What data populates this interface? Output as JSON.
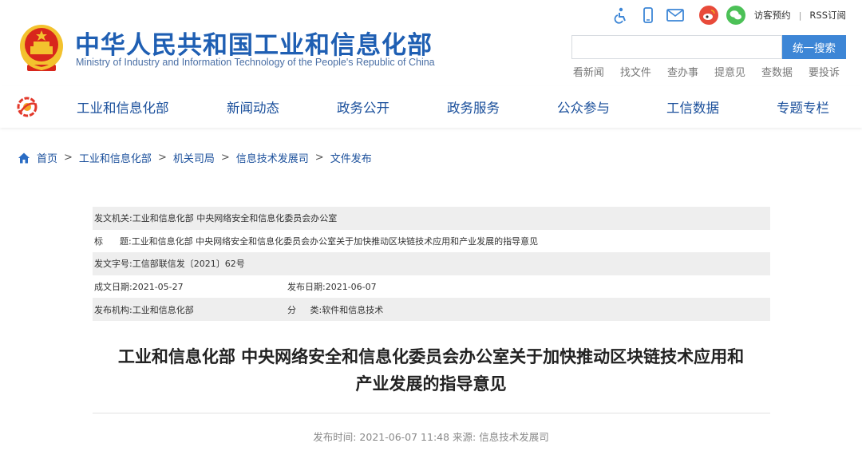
{
  "header": {
    "title": "中华人民共和国工业和信息化部",
    "subtitle": "Ministry of Industry and Information Technology of the People's Republic of China",
    "tools": {
      "icons": [
        "accessibility-icon",
        "mobile-icon",
        "mail-icon",
        "weibo-icon",
        "wechat-icon"
      ],
      "visitor_label": "访客预约",
      "sep": "|",
      "rss_label": "RSS订阅"
    },
    "search": {
      "placeholder": "",
      "button_label": "统一搜索"
    },
    "quick_links": [
      "看新闻",
      "找文件",
      "查办事",
      "提意见",
      "查数据",
      "要投诉"
    ]
  },
  "nav": {
    "items": [
      "工业和信息化部",
      "新闻动态",
      "政务公开",
      "政务服务",
      "公众参与",
      "工信数据",
      "专题专栏"
    ]
  },
  "breadcrumb": {
    "items": [
      "首页",
      "工业和信息化部",
      "机关司局",
      "信息技术发展司",
      "文件发布"
    ],
    "sep": ">"
  },
  "meta": {
    "issuer_label": "发文机关:",
    "issuer_value": "工业和信息化部 中央网络安全和信息化委员会办公室",
    "title_label": "标      题:",
    "title_value": "工业和信息化部 中央网络安全和信息化委员会办公室关于加快推动区块链技术应用和产业发展的指导意见",
    "docno_label": "发文字号:",
    "docno_value": "工信部联信发〔2021〕62号",
    "created_label": "成文日期:",
    "created_value": "2021-05-27",
    "published_label": "发布日期:",
    "published_value": "2021-06-07",
    "org_label": "发布机构:",
    "org_value": "工业和信息化部",
    "category_label": "分     类:",
    "category_value": "软件和信息技术"
  },
  "article": {
    "title_line1": "工业和信息化部 中央网络安全和信息化委员会办公室关于加快推动区块链技术应用和",
    "title_line2": "产业发展的指导意见",
    "pub_time_label": "发布时间:",
    "pub_time": "2021-06-07 11:48",
    "source_label": "来源:",
    "source": "信息技术发展司"
  },
  "colors": {
    "brand_blue": "#1f5fb3",
    "nav_blue": "#1a4f9b",
    "search_button": "#3d86d6",
    "meta_shade": "#eeeeee",
    "emblem_red": "#d8261c",
    "emblem_gold": "#f3c22e"
  }
}
